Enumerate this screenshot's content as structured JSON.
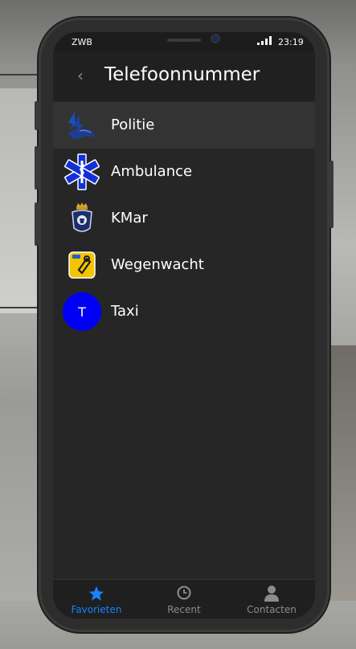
{
  "status_bar": {
    "carrier": "ZWB",
    "time": "23:19"
  },
  "header": {
    "title": "Telefoonnummer",
    "back_icon": "chevron-left-icon"
  },
  "contacts": [
    {
      "label": "Politie",
      "icon": "police-logo-icon",
      "selected": true
    },
    {
      "label": "Ambulance",
      "icon": "star-of-life-icon",
      "selected": false
    },
    {
      "label": "KMar",
      "icon": "kmar-emblem-icon",
      "selected": false
    },
    {
      "label": "Wegenwacht",
      "icon": "wegenwacht-logo-icon",
      "selected": false
    },
    {
      "label": "Taxi",
      "icon": "taxi-avatar",
      "avatar_letter": "T",
      "avatar_color": "#0000f5",
      "selected": false
    }
  ],
  "tabs": [
    {
      "label": "Favorieten",
      "icon": "star-icon",
      "active": true
    },
    {
      "label": "Recent",
      "icon": "clock-icon",
      "active": false
    },
    {
      "label": "Contacten",
      "icon": "person-icon",
      "active": false
    }
  ],
  "colors": {
    "accent": "#1683ff",
    "screen_bg": "#262626",
    "selected_row": "#333333"
  }
}
